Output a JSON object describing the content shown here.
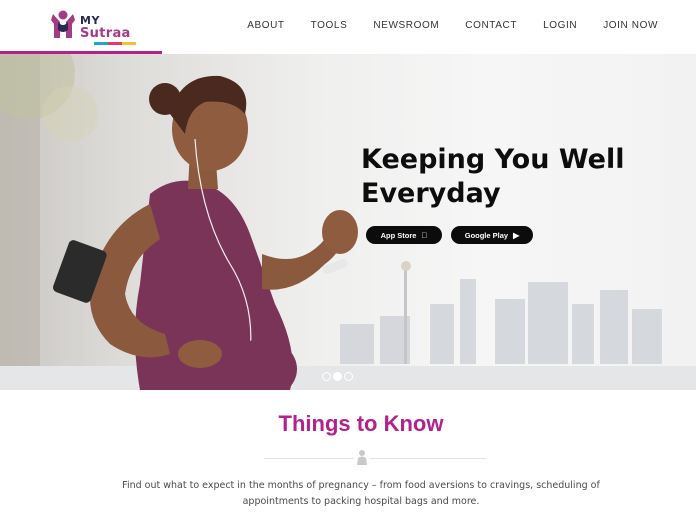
{
  "brand": {
    "my": "MY",
    "name": "Sutraa",
    "accent": "#b3218f"
  },
  "nav": {
    "items": [
      {
        "label": "ABOUT"
      },
      {
        "label": "TOOLS"
      },
      {
        "label": "NEWSROOM"
      },
      {
        "label": "CONTACT"
      },
      {
        "label": "LOGIN"
      },
      {
        "label": "JOIN NOW"
      }
    ]
  },
  "hero": {
    "title": "Keeping You Well Everyday",
    "app_store_label": "App Store",
    "app_store_icon": "apple-icon",
    "google_play_label": "Google Play",
    "google_play_icon": "play-icon",
    "slides": {
      "count": 3,
      "active": 2
    }
  },
  "section": {
    "title": "Things to Know",
    "divider_icon": "person-icon",
    "text": "Find out what to expect in the months of pregnancy – from food aversions to cravings, scheduling of appointments to packing hospital bags and more."
  }
}
